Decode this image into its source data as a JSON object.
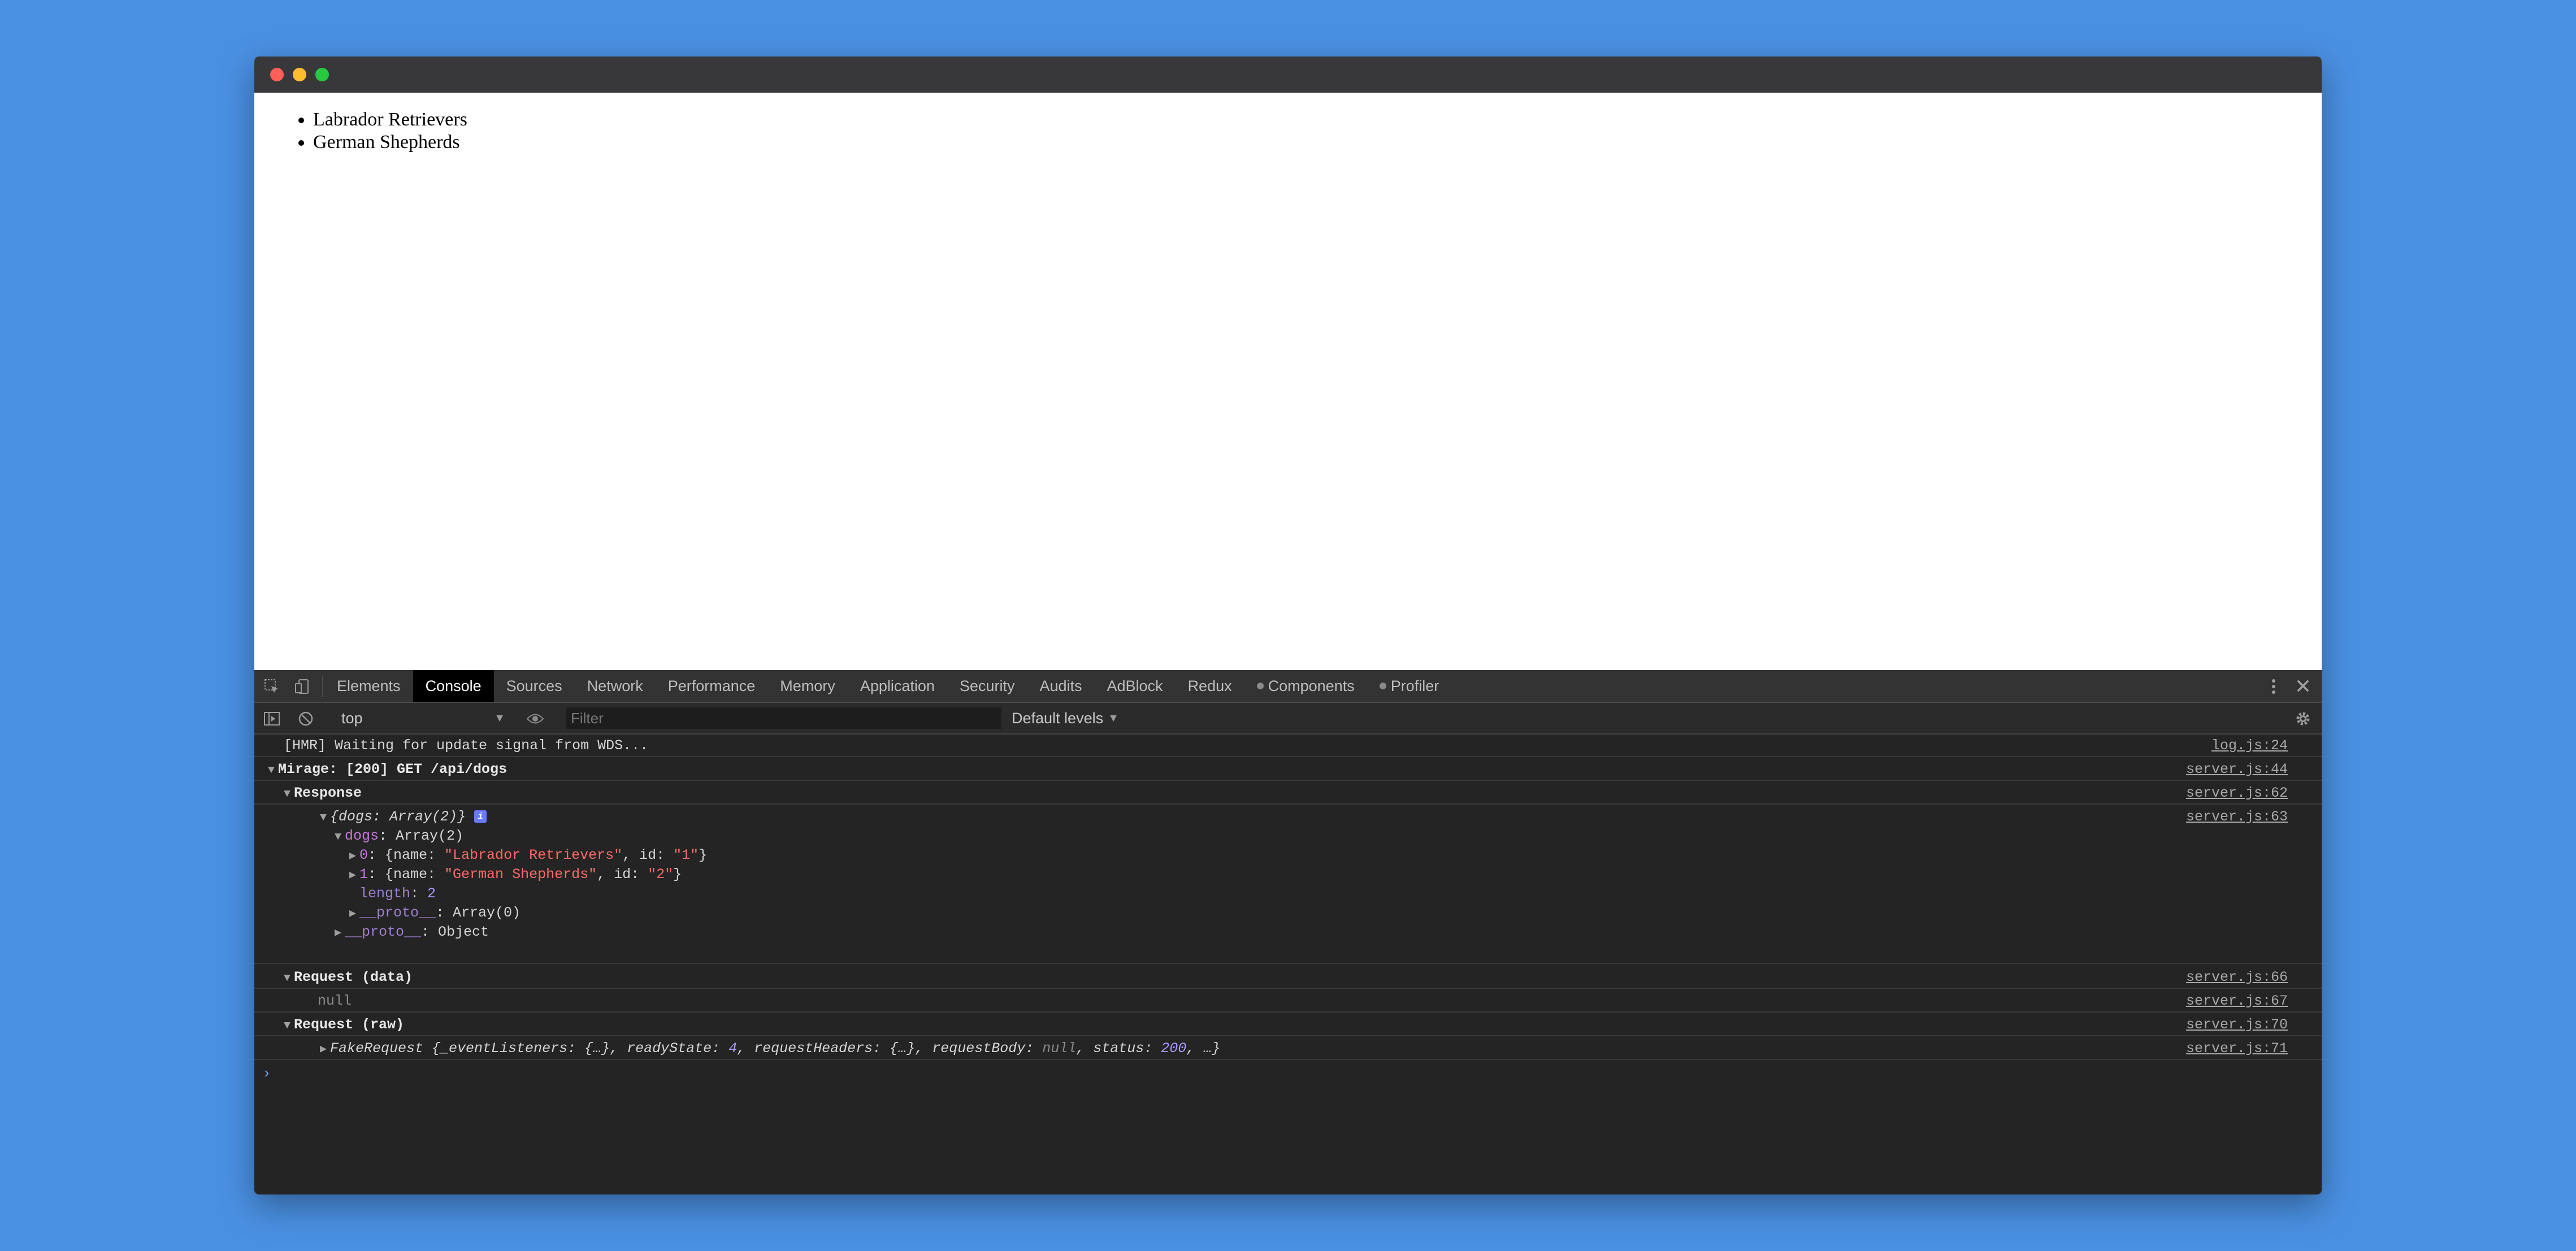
{
  "page": {
    "list": [
      "Labrador Retrievers",
      "German Shepherds"
    ]
  },
  "devtools": {
    "tabs": [
      {
        "label": "Elements",
        "name": "tab-elements"
      },
      {
        "label": "Console",
        "name": "tab-console"
      },
      {
        "label": "Sources",
        "name": "tab-sources"
      },
      {
        "label": "Network",
        "name": "tab-network"
      },
      {
        "label": "Performance",
        "name": "tab-performance"
      },
      {
        "label": "Memory",
        "name": "tab-memory"
      },
      {
        "label": "Application",
        "name": "tab-application"
      },
      {
        "label": "Security",
        "name": "tab-security"
      },
      {
        "label": "Audits",
        "name": "tab-audits"
      },
      {
        "label": "AdBlock",
        "name": "tab-adblock"
      },
      {
        "label": "Redux",
        "name": "tab-redux"
      },
      {
        "label": "Components",
        "name": "tab-components"
      },
      {
        "label": "Profiler",
        "name": "tab-profiler"
      }
    ],
    "active_tab": "Console",
    "context": "top",
    "filter_placeholder": "Filter",
    "levels": "Default levels",
    "close_glyph": "✕"
  },
  "console": {
    "hmr": {
      "text": "[HMR] Waiting for update signal from WDS...",
      "src": "log.js:24"
    },
    "mirage": {
      "text": "Mirage: [200] GET /api/dogs",
      "src": "server.js:44"
    },
    "response": {
      "label": "Response",
      "src": "server.js:62"
    },
    "obj": {
      "prefix": "{dogs: ",
      "type": "Array(2)",
      "suffix": "}",
      "info": "i",
      "src": "server.js:63",
      "dogs_key": "dogs",
      "dogs_val": ": Array(2)",
      "item0": {
        "idx": "0",
        "pre": ": {name: ",
        "name": "\"Labrador Retrievers\"",
        "mid": ", id: ",
        "id": "\"1\"",
        "post": "}"
      },
      "item1": {
        "idx": "1",
        "pre": ": {name: ",
        "name": "\"German Shepherds\"",
        "mid": ", id: ",
        "id": "\"2\"",
        "post": "}"
      },
      "length_key": "length",
      "length_sep": ": ",
      "length_val": "2",
      "proto1_key": "__proto__",
      "proto1_val": ": Array(0)",
      "proto2_key": "__proto__",
      "proto2_val": ": Object"
    },
    "request_data": {
      "label": "Request (data)",
      "src": "server.js:66",
      "value": "null",
      "value_src": "server.js:67"
    },
    "request_raw": {
      "label": "Request (raw)",
      "src": "server.js:70",
      "fake_name": "FakeRequest",
      "p1": " {_eventListeners: {…}, readyState: ",
      "p1v": "4",
      "p2": ", requestHeaders: {…}, requestBody: ",
      "p2v": "null",
      "p3": ", status: ",
      "p3v": "200",
      "p4": ", …}",
      "value_src": "server.js:71"
    },
    "prompt": "›"
  }
}
